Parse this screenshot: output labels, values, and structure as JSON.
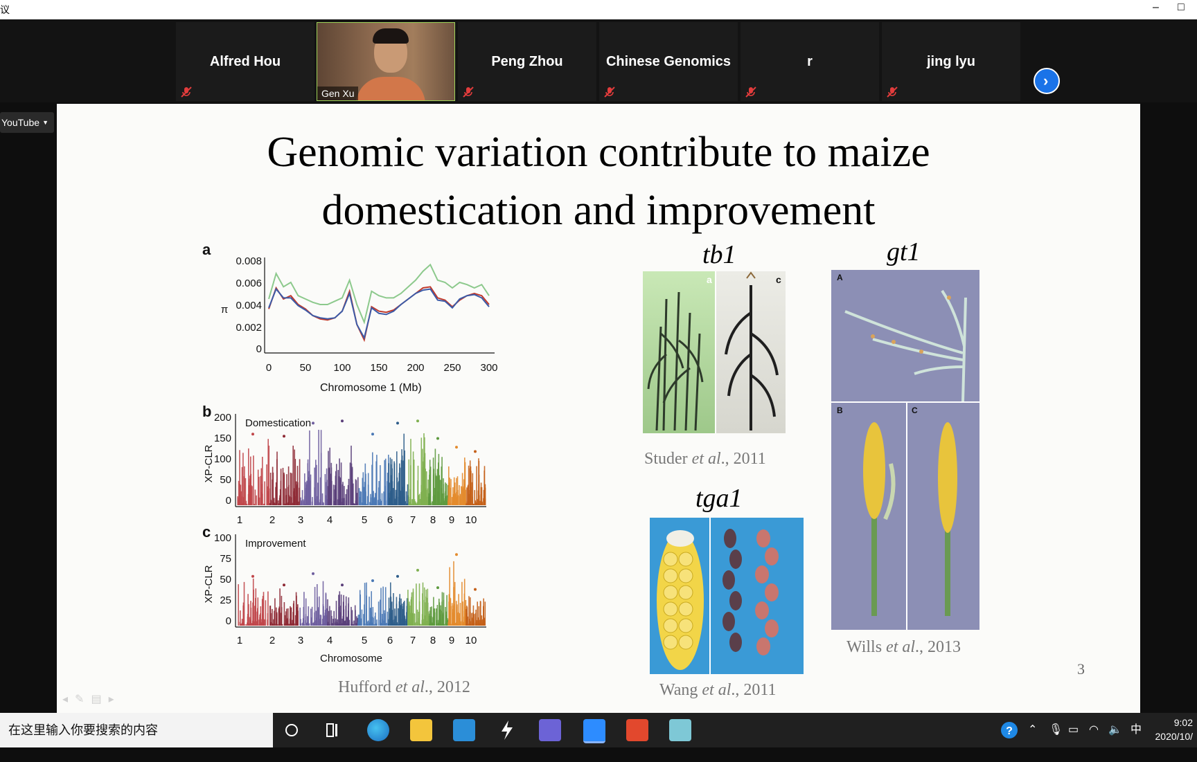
{
  "window": {
    "left_glyph": "议",
    "minimize": "–",
    "maximize": "□"
  },
  "participants": [
    {
      "name": "Alfred Hou",
      "muted": true
    },
    {
      "name": "Gen Xu",
      "video": true
    },
    {
      "name": "Peng Zhou",
      "muted": true
    },
    {
      "name": "Chinese Genomics",
      "muted": true
    },
    {
      "name": "r",
      "muted": true
    },
    {
      "name": "jing lyu",
      "muted": true
    }
  ],
  "next_label": "›",
  "youtube_dropdown": "YouTube",
  "slide": {
    "title_line1": "Genomic variation contribute to maize",
    "title_line2": "domestication and improvement",
    "page_number": "3",
    "citations": {
      "hufford": {
        "name": "Hufford ",
        "etal": "et al",
        "year": "., 2012"
      },
      "studer": {
        "name": "Studer ",
        "etal": "et al",
        "year": "., 2011"
      },
      "wang": {
        "name": "Wang ",
        "etal": "et al",
        "year": "., 2011"
      },
      "wills": {
        "name": "Wills ",
        "etal": "et al",
        "year": "., 2013"
      }
    },
    "genes": {
      "tb1": "tb1",
      "tga1": "tga1",
      "gt1": "gt1"
    },
    "photo_labels": {
      "tb1_a": "a",
      "tb1_c": "c",
      "gt1_A": "A",
      "gt1_B": "B",
      "gt1_C": "C"
    }
  },
  "chart_data": [
    {
      "type": "line",
      "panel": "a",
      "xlabel": "Chromosome 1 (Mb)",
      "ylabel": "π",
      "xlim": [
        0,
        300
      ],
      "ylim": [
        0,
        0.008
      ],
      "xticks": [
        "0",
        "50",
        "100",
        "150",
        "200",
        "250",
        "300"
      ],
      "yticks": [
        "0",
        "0.002",
        "0.004",
        "0.006",
        "0.008"
      ],
      "x": [
        0,
        10,
        20,
        30,
        40,
        50,
        60,
        70,
        80,
        90,
        100,
        110,
        120,
        130,
        140,
        150,
        160,
        170,
        180,
        190,
        200,
        210,
        220,
        230,
        240,
        250,
        260,
        270,
        280,
        290,
        300
      ],
      "series": [
        {
          "color": "#8cc98c",
          "values": [
            0.0045,
            0.0068,
            0.0056,
            0.006,
            0.0048,
            0.0045,
            0.0042,
            0.004,
            0.004,
            0.0043,
            0.0046,
            0.0062,
            0.004,
            0.0024,
            0.0052,
            0.0048,
            0.0046,
            0.0046,
            0.005,
            0.0056,
            0.0062,
            0.007,
            0.0076,
            0.0062,
            0.006,
            0.0055,
            0.006,
            0.0058,
            0.0055,
            0.0058,
            0.0048
          ]
        },
        {
          "color": "#c0392b",
          "values": [
            0.0036,
            0.0055,
            0.0045,
            0.0048,
            0.004,
            0.0036,
            0.003,
            0.0027,
            0.0026,
            0.0028,
            0.0034,
            0.0052,
            0.0022,
            0.0008,
            0.0038,
            0.0034,
            0.0033,
            0.0035,
            0.004,
            0.0045,
            0.005,
            0.0055,
            0.0056,
            0.0046,
            0.0044,
            0.0038,
            0.0044,
            0.0048,
            0.005,
            0.0048,
            0.004
          ]
        },
        {
          "color": "#3b5ba8",
          "values": [
            0.0037,
            0.0054,
            0.0046,
            0.0046,
            0.0039,
            0.0035,
            0.003,
            0.0028,
            0.0027,
            0.0028,
            0.0034,
            0.005,
            0.0022,
            0.001,
            0.0037,
            0.0032,
            0.0031,
            0.0034,
            0.004,
            0.0045,
            0.005,
            0.0053,
            0.0054,
            0.0044,
            0.0043,
            0.0037,
            0.0045,
            0.0048,
            0.0049,
            0.0046,
            0.0038
          ]
        }
      ]
    },
    {
      "type": "scatter",
      "panel": "b",
      "annotation": "Domestication",
      "ylabel": "XP-CLR",
      "ylim": [
        0,
        200
      ],
      "yticks": [
        "0",
        "50",
        "100",
        "150",
        "200"
      ],
      "categories": [
        "1",
        "2",
        "3",
        "4",
        "5",
        "6",
        "7",
        "8",
        "9",
        "10"
      ],
      "peaks": [
        160,
        155,
        185,
        190,
        160,
        185,
        190,
        150,
        130,
        120
      ],
      "colors": [
        "#c0464a",
        "#8e2a35",
        "#6e5e9e",
        "#5a3f7a",
        "#4a78b5",
        "#2e5d8a",
        "#7fb050",
        "#5e9a3f",
        "#e38b2e",
        "#c4601a"
      ]
    },
    {
      "type": "scatter",
      "panel": "c",
      "annotation": "Improvement",
      "xlabel": "Chromosome",
      "ylabel": "XP-CLR",
      "ylim": [
        0,
        100
      ],
      "yticks": [
        "0",
        "25",
        "50",
        "75",
        "100"
      ],
      "categories": [
        "1",
        "2",
        "3",
        "4",
        "5",
        "6",
        "7",
        "8",
        "9",
        "10"
      ],
      "peaks": [
        55,
        45,
        58,
        45,
        50,
        55,
        62,
        42,
        80,
        40
      ],
      "colors": [
        "#c0464a",
        "#8e2a35",
        "#6e5e9e",
        "#5a3f7a",
        "#4a78b5",
        "#2e5d8a",
        "#7fb050",
        "#5e9a3f",
        "#e38b2e",
        "#c4601a"
      ]
    }
  ],
  "taskbar": {
    "search_placeholder": "在这里输入你要搜索的内容",
    "ime": "中",
    "time": "9:02",
    "date": "2020/10/"
  }
}
